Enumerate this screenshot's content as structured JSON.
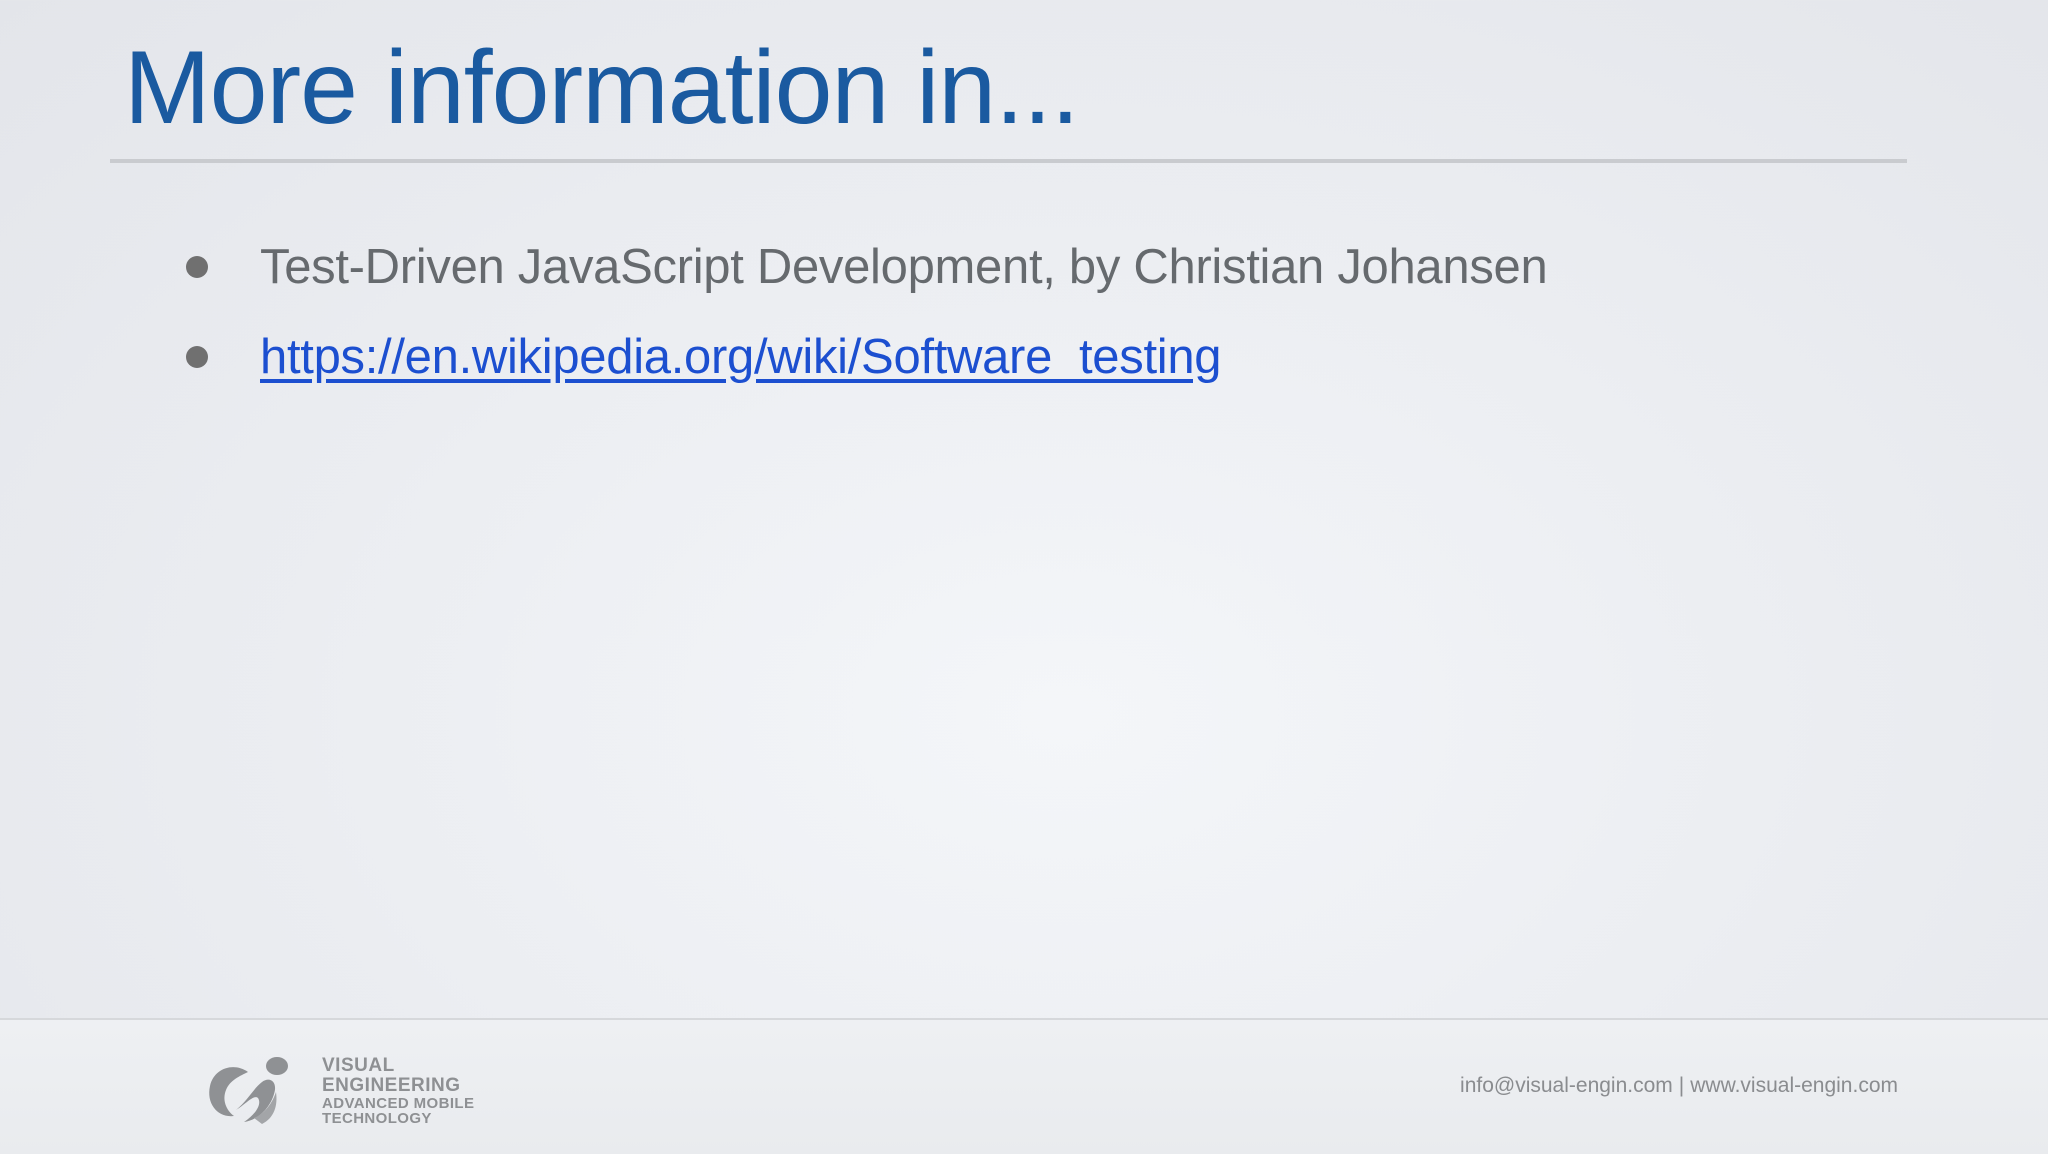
{
  "slide": {
    "title": "More information in...",
    "bullets": [
      {
        "text": "Test-Driven JavaScript Development, by Christian Johansen",
        "is_link": false
      },
      {
        "text": "https://en.wikipedia.org/wiki/Software_testing",
        "is_link": true
      }
    ]
  },
  "footer": {
    "logo": {
      "line1": "VISUAL",
      "line2": "ENGINEERING",
      "line3": "ADVANCED MOBILE",
      "line4": "TECHNOLOGY"
    },
    "email": "info@visual-engin.com",
    "separator": "|",
    "website": "www.visual-engin.com"
  },
  "colors": {
    "title": "#1a5aa0",
    "body_text": "#666a6e",
    "link": "#1c4fd0",
    "footer_text": "#8a8c8f"
  },
  "icons": {
    "logo_mark": "visual-engineering-logo-icon"
  }
}
